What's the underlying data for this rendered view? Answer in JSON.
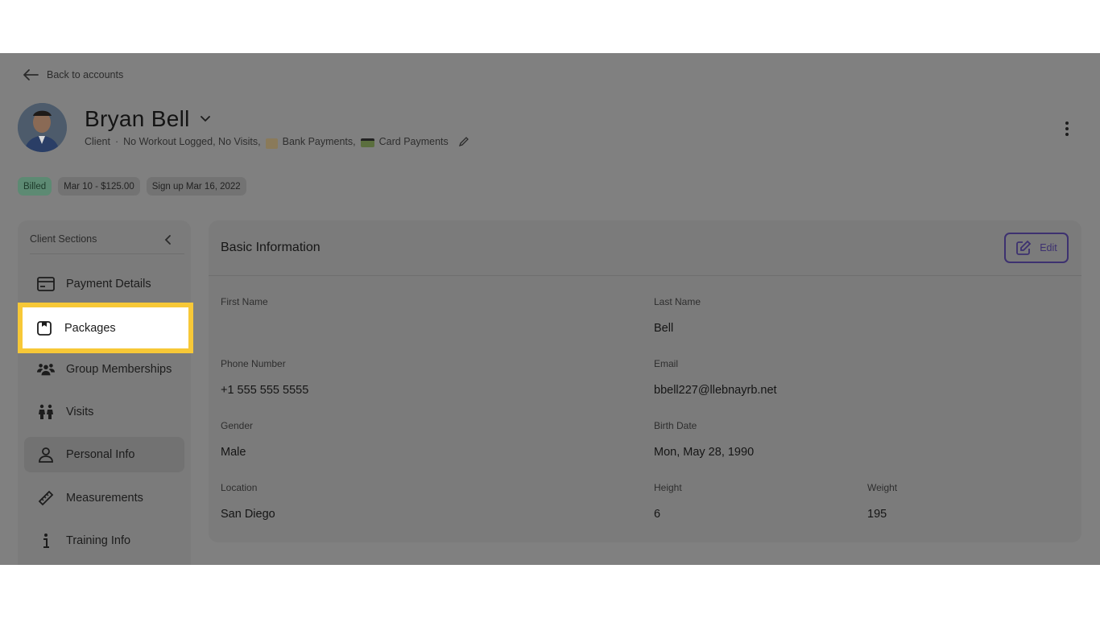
{
  "header": {
    "back_label": "Back to accounts",
    "client_name": "Bryan Bell",
    "role": "Client",
    "separator": "·",
    "status_text": "No Workout Logged, No Visits,",
    "bank_payments": "Bank Payments,",
    "card_payments": "Card Payments"
  },
  "badges": {
    "billed": "Billed",
    "next_bill": "Mar 10 - $125.00",
    "signup": "Sign up Mar 16, 2022"
  },
  "sidebar": {
    "title": "Client Sections",
    "items": [
      {
        "label": "Payment Details",
        "icon": "credit-card-icon"
      },
      {
        "label": "Packages",
        "icon": "package-icon"
      },
      {
        "label": "Group Memberships",
        "icon": "group-icon"
      },
      {
        "label": "Visits",
        "icon": "visits-icon"
      },
      {
        "label": "Personal Info",
        "icon": "person-icon"
      },
      {
        "label": "Measurements",
        "icon": "ruler-icon"
      },
      {
        "label": "Training Info",
        "icon": "info-icon"
      }
    ]
  },
  "basic_info": {
    "title": "Basic Information",
    "edit_label": "Edit",
    "first_name_label": "First Name",
    "first_name_value": "",
    "last_name_label": "Last Name",
    "last_name_value": "Bell",
    "phone_label": "Phone Number",
    "phone_value": "+1 555 555 5555",
    "email_label": "Email",
    "email_value": "bbell227@llebnayrb.net",
    "gender_label": "Gender",
    "gender_value": "Male",
    "birth_label": "Birth Date",
    "birth_value": "Mon, May 28, 1990",
    "location_label": "Location",
    "location_value": "San Diego",
    "height_label": "Height",
    "height_value": "6",
    "weight_label": "Weight",
    "weight_value": "195"
  },
  "colors": {
    "overlay": "#808080",
    "highlight": "#f7c837",
    "edit_accent": "#3d3170",
    "billed_badge": "#5d8a73"
  }
}
